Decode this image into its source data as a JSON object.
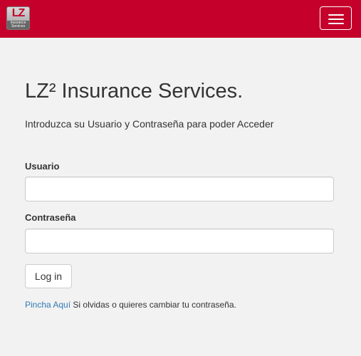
{
  "header": {
    "logo_main": "LZ",
    "logo_sub_1": "Insurance",
    "logo_sub_2": "Services",
    "brand_color": "#c4002b"
  },
  "main": {
    "title": "LZ² Insurance Services.",
    "subtitle": "Introduzca su Usuario y Contraseña para poder Acceder",
    "username_label": "Usuario",
    "username_value": "",
    "password_label": "Contraseña",
    "password_value": "",
    "login_label": "Log in",
    "help_link": "Pincha Aquí",
    "help_text": " Si olvidas o quieres cambiar tu contraseña.",
    "link_color": "#337ab7"
  }
}
